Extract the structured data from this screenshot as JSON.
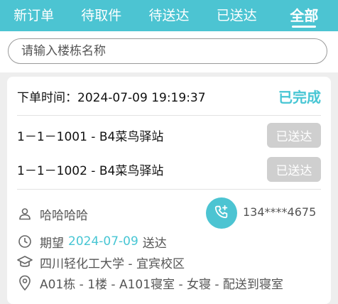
{
  "tabs": [
    {
      "label": "新订单",
      "active": false
    },
    {
      "label": "待取件",
      "active": false
    },
    {
      "label": "待送达",
      "active": false
    },
    {
      "label": "已送达",
      "active": false
    },
    {
      "label": "全部",
      "active": true
    }
  ],
  "search": {
    "placeholder": "请输入楼栋名称",
    "value": ""
  },
  "order": {
    "time_label": "下单时间：",
    "time_value": "2024-07-09 19:19:37",
    "status": "已完成",
    "items": [
      {
        "name": "1－1－1001 - B4菜鸟驿站",
        "button": "已送达"
      },
      {
        "name": "1－1－1002 - B4菜鸟驿站",
        "button": "已送达"
      }
    ],
    "customer_name": "哈哈哈哈",
    "phone": "134****4675",
    "expect_prefix": "期望",
    "expect_date": "2024-07-09",
    "expect_suffix": "送达",
    "school": "四川轻化工大学 - 宜宾校区",
    "address": "A01栋 - 1楼 - A101寝室 - 女寝 - 配送到寝室"
  },
  "colors": {
    "accent": "#4cc4d2",
    "status": "#47c6d4",
    "disabled_button": "#cfcfcf"
  },
  "icons": [
    "user-icon",
    "phone-call-icon",
    "clock-icon",
    "graduation-cap-icon",
    "location-pin-icon"
  ]
}
